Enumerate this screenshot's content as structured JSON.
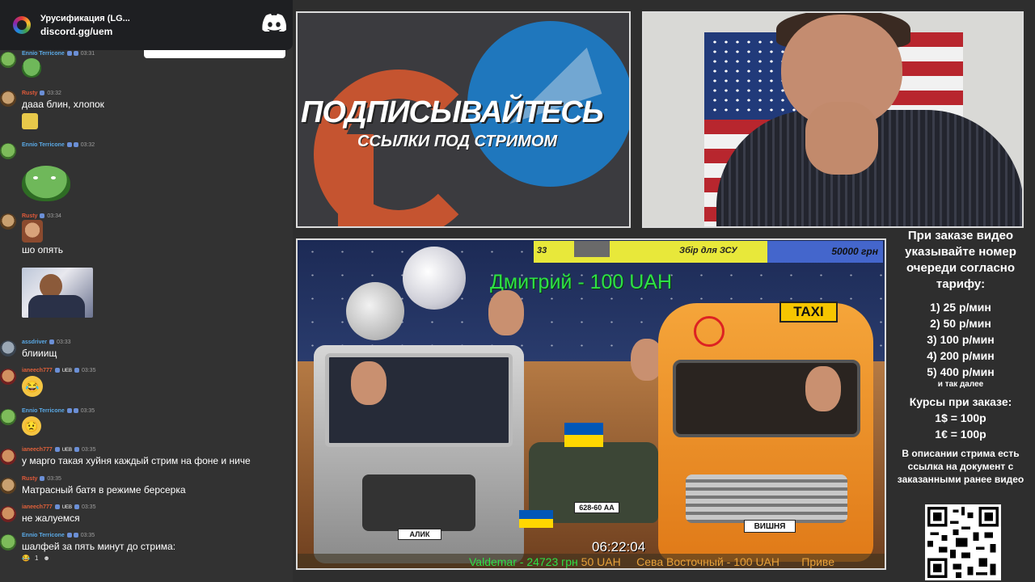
{
  "discord": {
    "server_name": "Урусификация (LG...",
    "server_link": "discord.gg/uem",
    "logo_icon": "discord-icon"
  },
  "chat": {
    "messages": [
      {
        "user": "Ennio Terricone",
        "time": "03:31",
        "text": "",
        "emote": "pepe-emote"
      },
      {
        "user": "Rusty",
        "time": "03:32",
        "text": "дааа блин, хлопок",
        "emote": "small-emote"
      },
      {
        "user": "Ennio Terricone",
        "time": "03:32",
        "text": "",
        "emote": "pepe-laugh-emote"
      },
      {
        "user": "Rusty",
        "time": "03:34",
        "text": "шо опять",
        "emote": "face-emote"
      },
      {
        "user": "",
        "time": "",
        "text": "",
        "emote": "webcam-clip-thumbnail"
      },
      {
        "user": "assdriver",
        "time": "03:33",
        "text": "блииищ"
      },
      {
        "user": "ianeech777",
        "badge": "UEB",
        "time": "03:35",
        "text": "",
        "emote": "laughing-emoji"
      },
      {
        "user": "Ennio Terricone",
        "time": "03:35",
        "text": "",
        "emote": "worried-emoji"
      },
      {
        "user": "ianeech777",
        "badge": "UEB",
        "time": "03:35",
        "text": "у марго такая хуйня каждый стрим на фоне и ниче"
      },
      {
        "user": "Rusty",
        "time": "03:35",
        "text": "Матрасный батя в режиме берсерка"
      },
      {
        "user": "ianeech777",
        "badge": "UEB",
        "time": "03:35",
        "text": "не жалуемся"
      },
      {
        "user": "Ennio Terricone",
        "time": "03:35",
        "text": "шалфей за пять минут до стрима:",
        "reaction_count": "1"
      }
    ]
  },
  "promo": {
    "title": "ПОДПИСЫВАЙТЕСЬ",
    "subtitle": "ССЫЛКИ ПОД СТРИМОМ"
  },
  "stream": {
    "donation_left": "33",
    "donation_goal_label": "Збір для ЗСУ",
    "donation_goal_amount": "50000 грн",
    "donation_progress": 0.67,
    "alert": "Дмитрий - 100 UAH",
    "taxi_sign": "TAXI",
    "van_plate": "ВИШНЯ",
    "truck_plate": "АЛИК",
    "tank_plate": "628-60 АА",
    "timer": "06:22:04",
    "ticker_1": "Valdemar - 24723 грн",
    "ticker_2": "50 UAH",
    "ticker_3": "Сева Восточный - 100 UAH",
    "ticker_4": "Приве"
  },
  "tariff": {
    "head": "При заказе видео указывайте номер очереди согласно тарифу:",
    "items": [
      "1) 25 р/мин",
      "2) 50 р/мин",
      "3) 100 р/мин",
      "4) 200 р/мин",
      "5) 400 р/мин"
    ],
    "more": "и так далее",
    "courses_title": "Курсы при заказе:",
    "rate_usd": "1$ = 100р",
    "rate_eur": "1€ = 100р",
    "description": "В описании стрима есть ссылка на документ с заказанными ранее видео"
  },
  "colors": {
    "chat_bg": "#323232",
    "discord_bg": "#1e1f22",
    "alert_green": "#2ee045",
    "donation_yellow": "#e8e83a",
    "donation_blue": "#4466cc"
  }
}
